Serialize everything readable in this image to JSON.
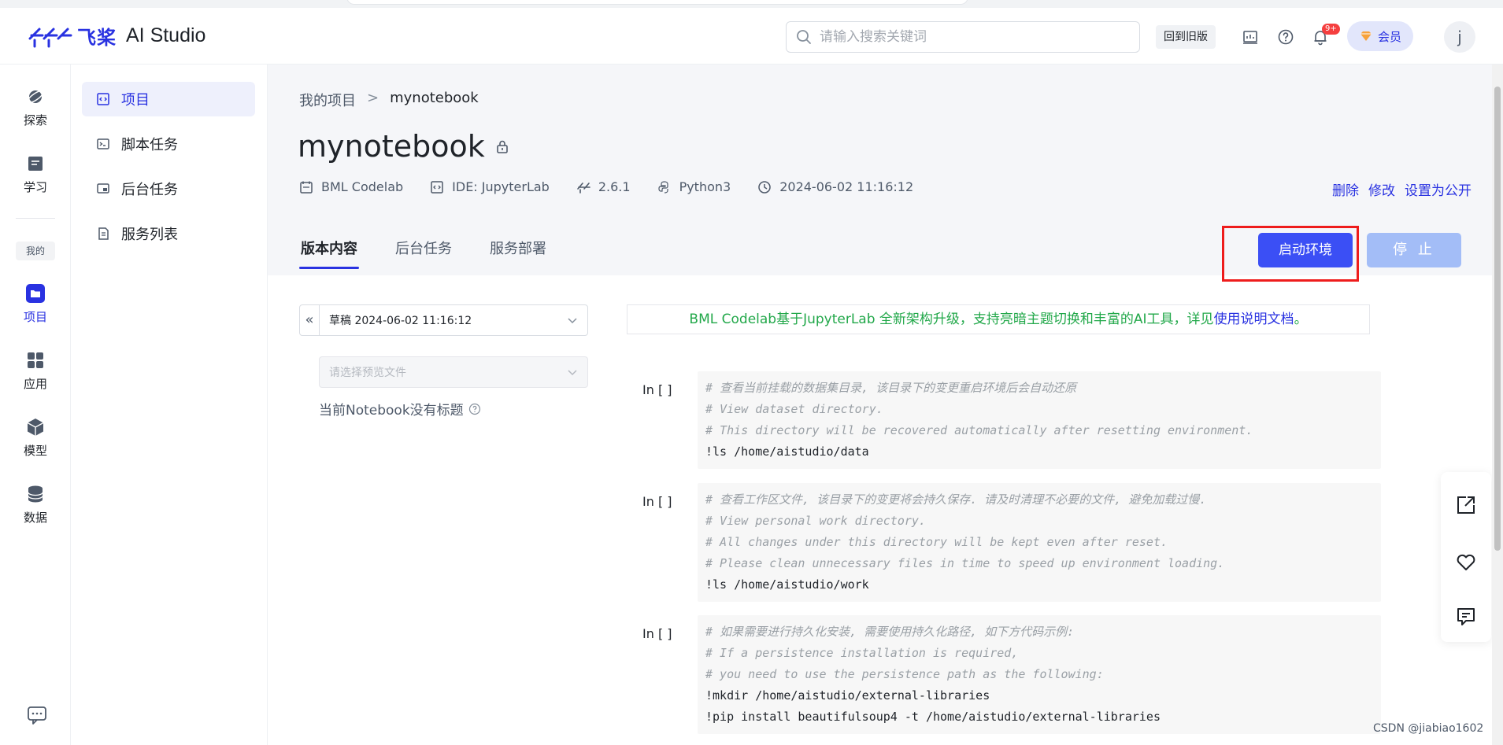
{
  "header": {
    "brand_cn": "飞桨",
    "brand_en": "AI Studio",
    "search_placeholder": "请输入搜索关键词",
    "old_version_label": "回到旧版",
    "notification_badge": "9+",
    "vip_label": "会员",
    "avatar_letter": "j"
  },
  "rail": {
    "items": [
      {
        "label": "探索"
      },
      {
        "label": "学习"
      },
      {
        "label": "项目"
      },
      {
        "label": "应用"
      },
      {
        "label": "模型"
      },
      {
        "label": "数据"
      }
    ],
    "mine_label": "我的",
    "active_label": "项目"
  },
  "subnav": {
    "items": [
      {
        "label": "项目"
      },
      {
        "label": "脚本任务"
      },
      {
        "label": "后台任务"
      },
      {
        "label": "服务列表"
      }
    ]
  },
  "breadcrumb": {
    "parent": "我的项目",
    "separator": ">",
    "current": "mynotebook"
  },
  "project": {
    "title": "mynotebook",
    "meta": {
      "env": "BML Codelab",
      "ide": "IDE: JupyterLab",
      "paddle_version": "2.6.1",
      "python": "Python3",
      "created": "2024-06-02 11:16:12"
    },
    "actions": {
      "delete": "删除",
      "edit": "修改",
      "make_public": "设置为公开"
    }
  },
  "tabs": [
    {
      "label": "版本内容",
      "active": true
    },
    {
      "label": "后台任务",
      "active": false
    },
    {
      "label": "服务部署",
      "active": false
    }
  ],
  "buttons": {
    "start": "启动环境",
    "stop": "停 止"
  },
  "left_panel": {
    "version_value": "草稿 2024-06-02 11:16:12",
    "file_placeholder": "请选择预览文件",
    "no_title": "当前Notebook没有标题"
  },
  "notice": {
    "text": "BML Codelab基于JupyterLab 全新架构升级，支持亮暗主题切换和丰富的AI工具，详见",
    "link": "使用说明文档",
    "suffix": "。"
  },
  "cells": [
    {
      "prompt": "In [ ]",
      "lines": [
        {
          "text": "# 查看当前挂载的数据集目录, 该目录下的变更重启环境后会自动还原",
          "comment": true
        },
        {
          "text": "# View dataset directory.",
          "comment": true
        },
        {
          "text": "# This directory will be recovered automatically after resetting environment.",
          "comment": true
        },
        {
          "text": "!ls /home/aistudio/data",
          "comment": false
        }
      ]
    },
    {
      "prompt": "In [ ]",
      "lines": [
        {
          "text": "# 查看工作区文件, 该目录下的变更将会持久保存. 请及时清理不必要的文件, 避免加载过慢.",
          "comment": true
        },
        {
          "text": "# View personal work directory.",
          "comment": true
        },
        {
          "text": "# All changes under this directory will be kept even after reset.",
          "comment": true
        },
        {
          "text": "# Please clean unnecessary files in time to speed up environment loading.",
          "comment": true
        },
        {
          "text": "!ls /home/aistudio/work",
          "comment": false
        }
      ]
    },
    {
      "prompt": "In [ ]",
      "lines": [
        {
          "text": "# 如果需要进行持久化安装, 需要使用持久化路径, 如下方代码示例:",
          "comment": true
        },
        {
          "text": "# If a persistence installation is required,",
          "comment": true
        },
        {
          "text": "# you need to use the persistence path as the following:",
          "comment": true
        },
        {
          "text": "!mkdir /home/aistudio/external-libraries",
          "comment": false
        },
        {
          "text": "!pip install beautifulsoup4 -t /home/aistudio/external-libraries",
          "comment": false
        }
      ]
    }
  ],
  "watermark": "CSDN @jiabiao1602",
  "colors": {
    "accent": "#2932e1",
    "start_button": "#3b4ff5",
    "stop_button_disabled": "#a3bdf7",
    "highlight_box": "#ee1c1c",
    "notice_text": "#22a84a"
  }
}
